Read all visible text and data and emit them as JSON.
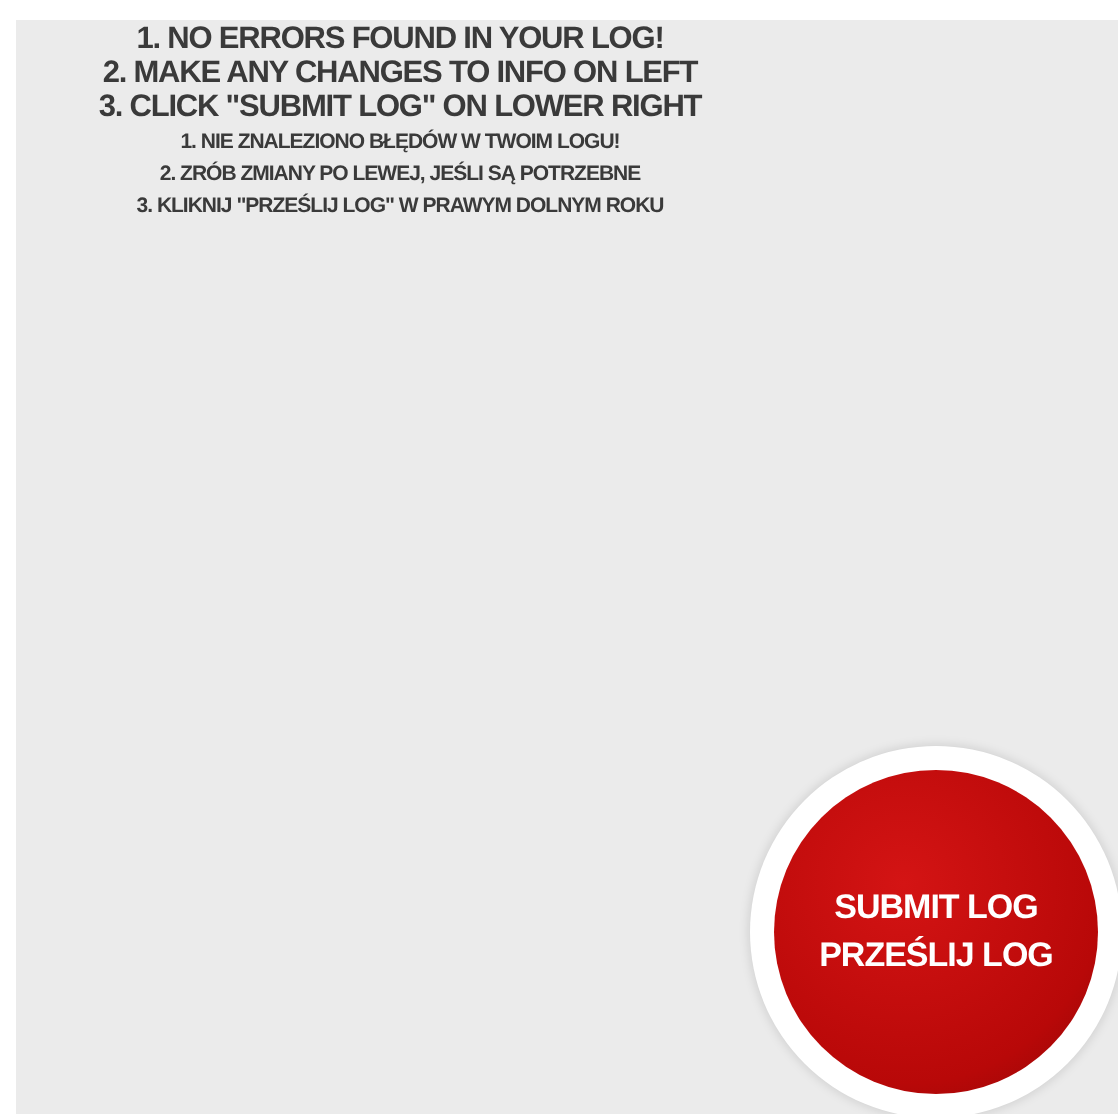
{
  "instructions_en": [
    "1. NO ERRORS FOUND IN YOUR LOG!",
    "2. MAKE ANY CHANGES TO INFO ON LEFT",
    "3. CLICK \"SUBMIT LOG\" ON LOWER RIGHT"
  ],
  "instructions_pl": [
    "1. NIE ZNALEZIONO BŁĘDÓW W TWOIM LOGU!",
    "2. ZRÓB ZMIANY PO LEWEJ, JEŚLI SĄ POTRZEBNE",
    "3. KLIKNIJ \"PRZEŚLIJ LOG\" W PRAWYM DOLNYM ROKU"
  ],
  "submit_button": {
    "lines": [
      "SUBMIT LOG",
      "PRZEŚLIJ LOG"
    ]
  }
}
